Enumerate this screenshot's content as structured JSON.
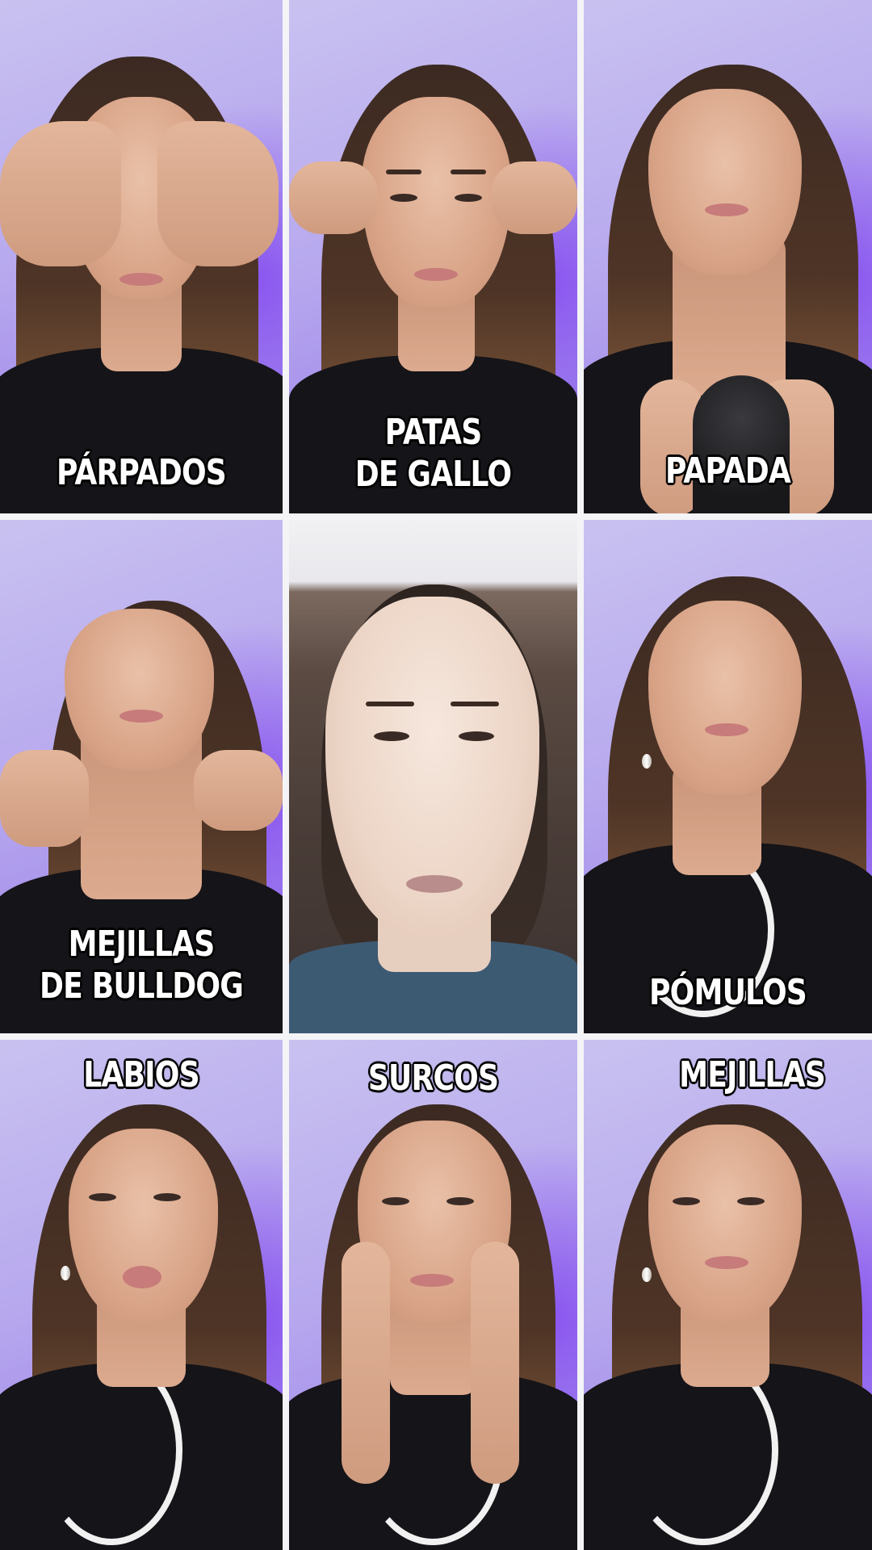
{
  "grid": {
    "tiles": [
      {
        "label": "PÁRPADOS",
        "background": "purple"
      },
      {
        "label": "PATAS\nDE GALLO",
        "background": "purple"
      },
      {
        "label": "PAPADA",
        "background": "purple"
      },
      {
        "label": "MEJILLAS\nDE BULLDOG",
        "background": "purple"
      },
      {
        "label": "",
        "background": "room"
      },
      {
        "label": "PÓMULOS",
        "background": "purple"
      },
      {
        "label": "LABIOS",
        "background": "purple"
      },
      {
        "label": "SURCOS",
        "background": "purple"
      },
      {
        "label": "MEJILLAS",
        "background": "purple"
      }
    ]
  },
  "colors": {
    "background_purple": "#b7a8ee",
    "label_text": "#ffffff",
    "label_outline": "#000000",
    "divider": "#f4f4f7"
  }
}
